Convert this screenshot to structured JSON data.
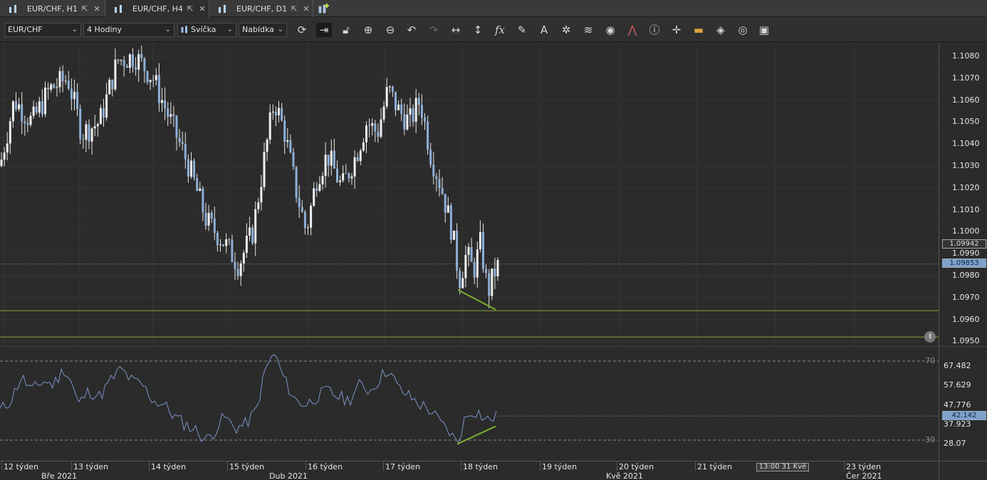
{
  "tabs": [
    {
      "label": "EUR/CHF, H1",
      "active": false
    },
    {
      "label": "EUR/CHF, H4",
      "active": true
    },
    {
      "label": "EUR/CHF, D1",
      "active": false
    }
  ],
  "toolbar": {
    "instrument": "EUR/CHF",
    "period": "4 Hodiny",
    "chart_type": "Svíčka",
    "offer_side": "Nabídka",
    "icons": [
      "refresh-icon",
      "auto-shift-icon",
      "unlock-icon",
      "zoom-in-icon",
      "zoom-out-icon",
      "undo-icon",
      "redo-icon",
      "horizontal-resize-icon",
      "vertical-resize-icon",
      "indicators-fx-icon",
      "pen-icon",
      "text-icon",
      "crosshair-icon",
      "layers-icon",
      "eye-icon",
      "alert-icon",
      "info-icon",
      "cursor-cross-icon",
      "ruler-icon",
      "fill-bucket-icon",
      "theme-icon",
      "save-icon"
    ]
  },
  "price_axis": {
    "labels": [
      "1.1080",
      "1.1070",
      "1.1060",
      "1.1050",
      "1.1040",
      "1.1030",
      "1.1020",
      "1.1010",
      "1.1000",
      "1.0990",
      "1.0980",
      "1.0970",
      "1.0960",
      "1.0950"
    ],
    "ask_tag": "1.09942",
    "bid_tag": "1.09853"
  },
  "rsi_axis": {
    "levels": [
      "70",
      "30"
    ],
    "labels": [
      "67.482",
      "57.629",
      "47.776",
      "37.923",
      "28.07"
    ],
    "current": "42.142"
  },
  "time_axis": {
    "weeks": [
      "12 týden",
      "13 týden",
      "14 týden",
      "15 týden",
      "16 týden",
      "17 týden",
      "18 týden",
      "19 týden",
      "20 týden",
      "21 týden",
      "23 týden"
    ],
    "months": [
      "Bře 2021",
      "Dub 2021",
      "Kvě 2021",
      "Čer 2021"
    ],
    "cursor_time": "13:00 31 Kvě"
  },
  "colors": {
    "candle_body": "#8db0d8",
    "candle_wick": "#e8e8e8",
    "support_line": "#8aa83c",
    "divergence_line": "#7ab030",
    "rsi_line": "#7b93c9",
    "bid_tag_bg": "#7fa2cc"
  },
  "chart_data": {
    "type": "candlestick",
    "instrument": "EUR/CHF",
    "timeframe": "4 Hodiny",
    "ylim": [
      1.0945,
      1.1086
    ],
    "approx_close_path": [
      {
        "x": "12 týden",
        "y": 1.103
      },
      {
        "x": "13 týden",
        "y": 1.1065
      },
      {
        "x": "14 týden",
        "y": 1.1075
      },
      {
        "x": "15 týden",
        "y": 1.0985
      },
      {
        "x": "15 týden",
        "y": 1.1055
      },
      {
        "x": "16 týden",
        "y": 1.103
      },
      {
        "x": "17 týden",
        "y": 1.1065
      },
      {
        "x": "18 týden",
        "y": 1.0975
      },
      {
        "x": "18 týden",
        "y": 1.0985
      }
    ],
    "support_levels": [
      1.0964,
      1.0952
    ],
    "rsi": {
      "period_levels": [
        70,
        30
      ],
      "last": 42.142
    }
  }
}
